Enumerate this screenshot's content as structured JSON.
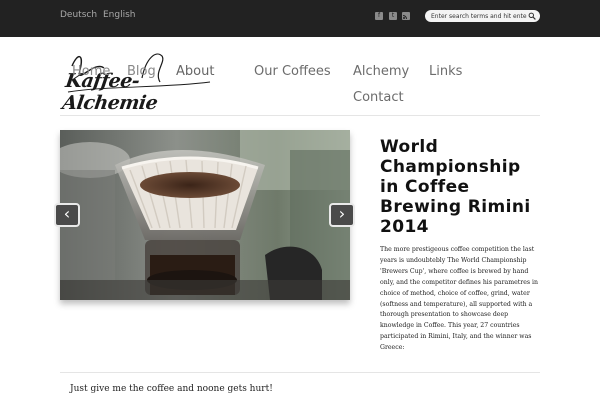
{
  "topbar": {
    "languages": [
      "Deutsch",
      "English"
    ],
    "social_icons": [
      "facebook-icon",
      "twitter-icon",
      "rss-icon"
    ],
    "search_placeholder": "Enter search terms and hit enter."
  },
  "logo": {
    "text": "Kaffee-Alchemie"
  },
  "nav": {
    "home": "Home",
    "blog": "Blog",
    "about": "About",
    "our_coffees": "Our Coffees",
    "alchemy": "Alchemy",
    "links": "Links",
    "contact": "Contact"
  },
  "slider": {
    "prev": "‹",
    "next": "›"
  },
  "article": {
    "title": "World Championship in Coffee Brewing Rimini 2014",
    "body": "The more prestigeous coffee competition the last years is undoubtebly The World Championship  'Brewers Cup', where coffee is brewed by hand only, and the competitor defines his parametres in choice of method, choice of coffee, grind, water (softness and temperature), all supported with a thorough presentation to showcase deep knowledge in Coffee. This year, 27 countries participated in Rimini, Italy, and the winner was Greece:"
  },
  "footer": {
    "tagline": "Just give me the coffee and noone gets hurt!"
  }
}
